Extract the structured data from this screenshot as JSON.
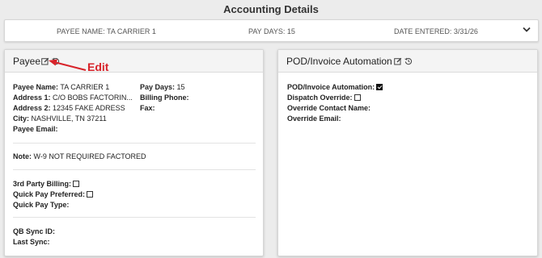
{
  "page": {
    "title": "Accounting Details"
  },
  "summary": {
    "payee_name": "PAYEE NAME: TA CARRIER 1",
    "pay_days": "PAY DAYS: 15",
    "date_entered": "DATE ENTERED: 3/31/26",
    "expand_icon": "chevron-down-icon"
  },
  "payee_card": {
    "title": "Payee",
    "edit_icon": "edit-icon",
    "history_icon": "history-icon",
    "fields": {
      "payee_name": {
        "label": "Payee Name:",
        "value": "TA CARRIER 1"
      },
      "address1": {
        "label": "Address 1:",
        "value": "C/O BOBS FACTORIN..."
      },
      "address2": {
        "label": "Address 2:",
        "value": "12345 FAKE ADRESS"
      },
      "city": {
        "label": "City:",
        "value": "NASHVILLE, TN 37211"
      },
      "payee_email": {
        "label": "Payee Email:",
        "value": ""
      },
      "pay_days": {
        "label": "Pay Days:",
        "value": "15"
      },
      "billing_phone": {
        "label": "Billing Phone:",
        "value": ""
      },
      "fax": {
        "label": "Fax:",
        "value": ""
      }
    },
    "note": {
      "label": "Note:",
      "value": "W-9 NOT REQUIRED FACTORED"
    },
    "billing": {
      "third_party": {
        "label": "3rd Party Billing:",
        "checked": false
      },
      "quick_pay_preferred": {
        "label": "Quick Pay Preferred:",
        "checked": false
      },
      "quick_pay_type": {
        "label": "Quick Pay Type:",
        "value": ""
      }
    },
    "sync": {
      "qb_sync_id": {
        "label": "QB Sync ID:",
        "value": ""
      },
      "last_sync": {
        "label": "Last Sync:",
        "value": ""
      }
    }
  },
  "pod_card": {
    "title": "POD/Invoice Automation",
    "edit_icon": "edit-icon",
    "history_icon": "history-icon",
    "fields": {
      "pod_automation": {
        "label": "POD/Invoice Automation:",
        "checked": true
      },
      "dispatch_override": {
        "label": "Dispatch Override:",
        "checked": false
      },
      "override_contact": {
        "label": "Override Contact Name:",
        "value": ""
      },
      "override_email": {
        "label": "Override Email:",
        "value": ""
      }
    }
  },
  "annotation": {
    "label": "Edit",
    "color": "#d8232a"
  }
}
